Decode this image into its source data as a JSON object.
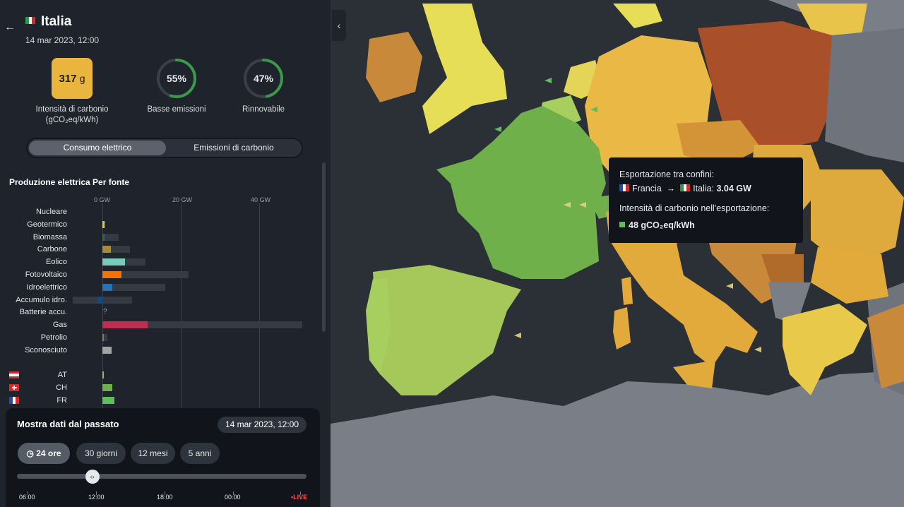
{
  "country": {
    "name": "Italia",
    "datetime": "14 mar 2023, 12:00"
  },
  "metrics": {
    "carbon_value": "317",
    "carbon_unit": "g",
    "carbon_label_1": "Intensità di carbonio",
    "carbon_label_2": "(gCO₂eq/kWh)",
    "low_emission_pct": "55%",
    "low_emission_label": "Basse emissioni",
    "low_emission_fraction": 0.55,
    "renewable_pct": "47%",
    "renewable_label": "Rinnovabile",
    "renewable_fraction": 0.47,
    "ring_color": "#3a9a4a"
  },
  "toggle": {
    "active": "Consumo elettrico",
    "other": "Emissioni di carbonio"
  },
  "production": {
    "title": "Produzione elettrica Per fonte",
    "axis": [
      "0 GW",
      "20 GW",
      "40 GW"
    ],
    "sources": [
      {
        "name": "Nucleare",
        "value": 0,
        "capacity": 0,
        "color": "#8a8a8a"
      },
      {
        "name": "Geotermico",
        "value": 0.6,
        "capacity": 0.8,
        "color": "#d9d21d"
      },
      {
        "name": "Biomassa",
        "value": 0.5,
        "capacity": 4.2,
        "color": "#2f6b3f"
      },
      {
        "name": "Carbone",
        "value": 2.2,
        "capacity": 7.0,
        "color": "#a88a3c"
      },
      {
        "name": "Eolico",
        "value": 5.8,
        "capacity": 11.0,
        "color": "#74cdb9"
      },
      {
        "name": "Fotovoltaico",
        "value": 4.8,
        "capacity": 22.0,
        "color": "#f27406"
      },
      {
        "name": "Idroelettrico",
        "value": 2.5,
        "capacity": 16.0,
        "color": "#2772b2"
      },
      {
        "name": "Accumulo idro.",
        "value": -1.0,
        "capacity": 7.5,
        "neg_capacity": 7.5,
        "color": "#0b4c8c"
      },
      {
        "name": "Batterie accu.",
        "value": 0,
        "capacity": 0,
        "color": "#8a8a8a",
        "unknown": "?"
      },
      {
        "name": "Gas",
        "value": 11.5,
        "capacity": 51.0,
        "color": "#bb2f51"
      },
      {
        "name": "Petrolio",
        "value": 0.3,
        "capacity": 1.2,
        "color": "#867d66"
      },
      {
        "name": "Sconosciuto",
        "value": 2.3,
        "capacity": 2.3,
        "color": "#a3a3a3"
      }
    ],
    "imports": [
      {
        "code": "AT",
        "value": 0.2,
        "color": "#a1b35a"
      },
      {
        "code": "CH",
        "value": 2.6,
        "color": "#6fb04a"
      },
      {
        "code": "FR",
        "value": 3.04,
        "color": "#5cbf5c"
      }
    ]
  },
  "past": {
    "title": "Mostra dati dal passato",
    "date": "14 mar 2023, 12:00",
    "options": [
      "24 ore",
      "30 giorni",
      "12 mesi",
      "5 anni"
    ],
    "selected": "24 ore",
    "ticks": [
      "06:00",
      "12:00",
      "18:00",
      "00:00"
    ],
    "live": "LIVE",
    "slider_position": 0.26
  },
  "tooltip": {
    "title": "Esportazione tra confini:",
    "from": "Francia",
    "arrow": "→",
    "to": "Italia",
    "to_sep": ":",
    "power": "3.04 GW",
    "intensity_title": "Intensità di carbonio nell'esportazione:",
    "intensity_value": "48 gCO₂eq/kWh"
  }
}
